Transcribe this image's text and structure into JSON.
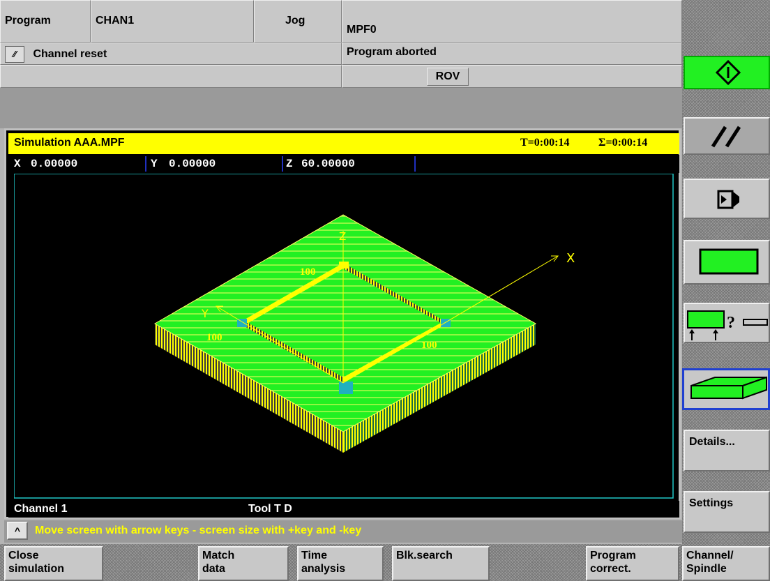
{
  "header": {
    "area": "Program",
    "channel": "CHAN1",
    "mode": "Jog",
    "program": "MPF0",
    "channel_status": "Channel reset",
    "program_status": "Program aborted",
    "rov": "ROV"
  },
  "simulation": {
    "title": "Simulation  AAA.MPF",
    "time": "T=0:00:14",
    "total": "Σ=0:00:14",
    "x_label": "X",
    "x_value": "0.00000",
    "y_label": "Y",
    "y_value": "0.00000",
    "z_label": "Z",
    "z_value": "60.00000",
    "axis_x": "X",
    "axis_y": "Y",
    "axis_z": "Z",
    "dim_top": "100",
    "dim_left": "100",
    "dim_right": "100",
    "footer_channel": "Channel 1",
    "footer_tool": "Tool T  D"
  },
  "message": {
    "text": "Move screen with arrow keys -  screen size with +key and -key"
  },
  "vertical_softkeys": {
    "details": "Details...",
    "settings": "Settings"
  },
  "horizontal_softkeys": [
    {
      "line1": "Close",
      "line2": "simulation"
    },
    {
      "line1": "",
      "line2": ""
    },
    {
      "line1": "Match",
      "line2": "data"
    },
    {
      "line1": "Time",
      "line2": "analysis"
    },
    {
      "line1": "Blk.search",
      "line2": ""
    },
    {
      "line1": "",
      "line2": ""
    },
    {
      "line1": "Program",
      "line2": "correct."
    },
    {
      "line1": "Channel/",
      "line2": "Spindle"
    }
  ],
  "colors": {
    "accent_green": "#22f022",
    "title_yellow": "#ffff00",
    "frame_cyan": "#20c8c8"
  },
  "icons": [
    "cycle-start-icon",
    "reset-icon",
    "program-icon",
    "block-icon",
    "workpiece-query-icon",
    "workpiece-3d-icon",
    "up-arrow-icon"
  ]
}
